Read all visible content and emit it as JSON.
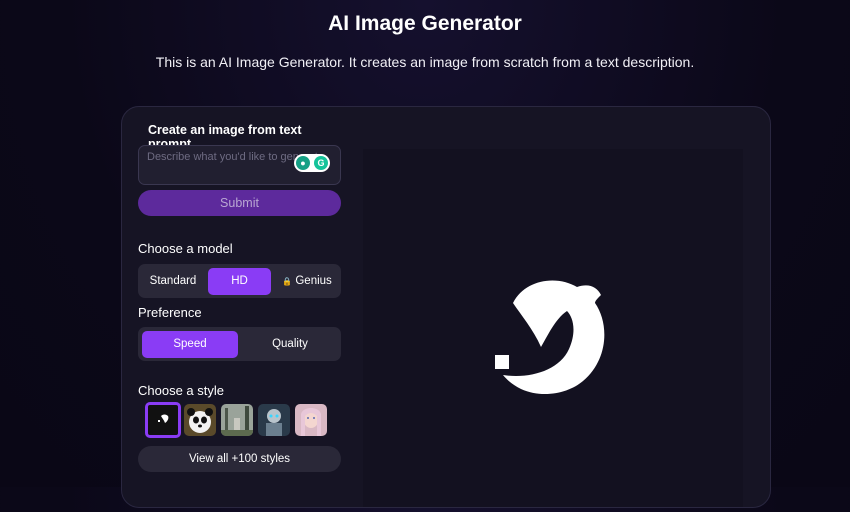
{
  "header": {
    "title": "AI Image Generator",
    "subtitle": "This is an AI Image Generator. It creates an image from scratch from a text description."
  },
  "prompt": {
    "label": "Create an image from text prompt",
    "placeholder": "Describe what you'd like to generate",
    "submit_label": "Submit"
  },
  "model": {
    "title": "Choose a model",
    "options": [
      "Standard",
      "HD",
      "Genius"
    ],
    "selected": "HD",
    "locked_icon": "lock-icon"
  },
  "preference": {
    "title": "Preference",
    "options": [
      "Speed",
      "Quality"
    ],
    "selected": "Speed"
  },
  "style": {
    "title": "Choose a style",
    "thumbnails": [
      "logo-style",
      "panda-style",
      "forest-style",
      "robot-style",
      "portrait-style"
    ],
    "view_all_label": "View all +100 styles"
  },
  "colors": {
    "accent": "#8a3cf5",
    "submit_bg": "#5d2a9c"
  }
}
